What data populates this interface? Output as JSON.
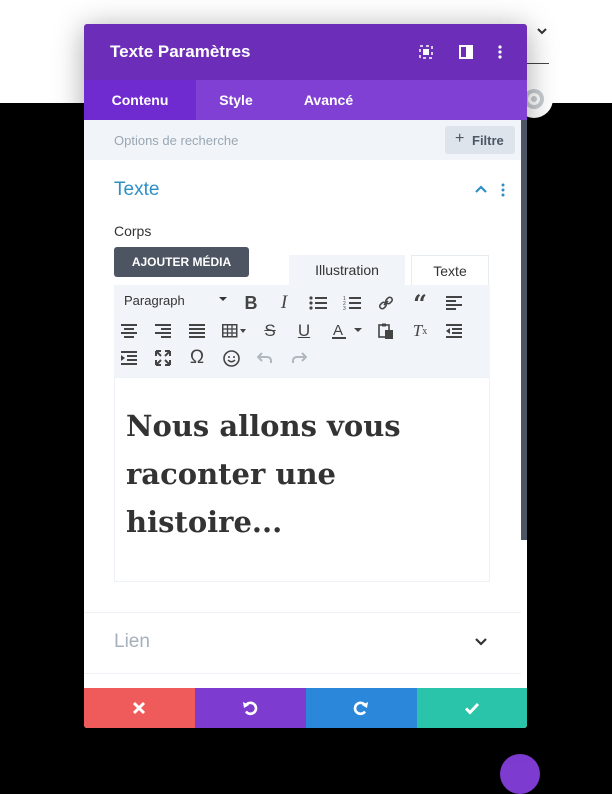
{
  "modal": {
    "title": "Texte Paramètres",
    "tabs": [
      {
        "label": "Contenu",
        "active": true
      },
      {
        "label": "Style",
        "active": false
      },
      {
        "label": "Avancé",
        "active": false
      }
    ]
  },
  "search": {
    "placeholder": "Options de recherche",
    "filter_label": "Filtre"
  },
  "section_text": {
    "title": "Texte",
    "body_label": "Corps",
    "add_media_label": "AJOUTER MÉDIA",
    "editor_tabs": [
      "Illustration",
      "Texte"
    ],
    "format_select": "Paragraph",
    "content": "Nous allons vous raconter une histoire..."
  },
  "section_link": {
    "title": "Lien"
  },
  "colors": {
    "header": "#6c2eb9",
    "tabs": "#8040d4",
    "section_title": "#2e8ec5",
    "cancel": "#ef5b5b",
    "undo": "#7e3bd0",
    "redo": "#2b87da",
    "save": "#29c4a9"
  },
  "icons": {
    "header": [
      "expand-icon",
      "split-view-icon",
      "more-vertical-icon"
    ],
    "toolbar": [
      "bold-icon",
      "italic-icon",
      "bullet-list-icon",
      "numbered-list-icon",
      "link-icon",
      "blockquote-icon",
      "align-left-icon",
      "align-center-icon",
      "align-right-icon",
      "align-justify-icon",
      "table-icon",
      "strikethrough-icon",
      "underline-icon",
      "text-color-icon",
      "paste-text-icon",
      "clear-formatting-icon",
      "outdent-icon",
      "indent-icon",
      "fullscreen-icon",
      "special-character-icon",
      "emoji-icon",
      "undo-icon",
      "redo-icon"
    ],
    "footer": [
      "close-icon",
      "undo-icon",
      "redo-icon",
      "check-icon"
    ]
  }
}
